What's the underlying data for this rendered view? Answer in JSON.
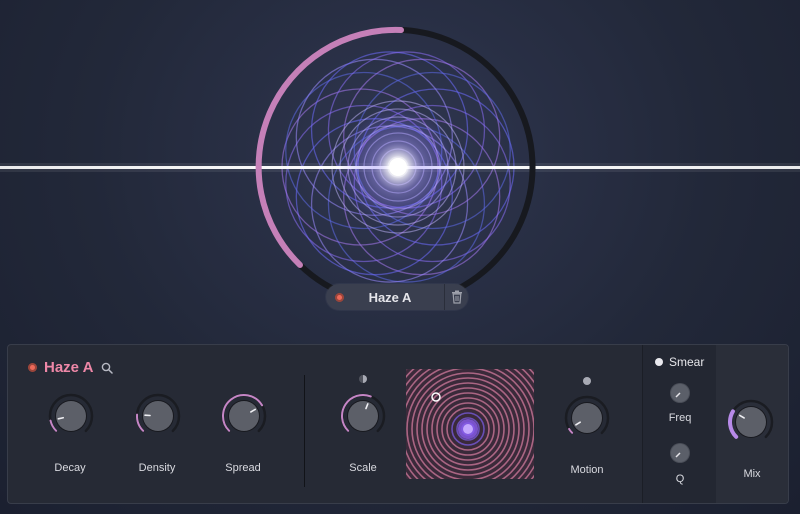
{
  "colors": {
    "accent_pink": "#ee87a7",
    "accent_purple": "#b582f0",
    "led_red": "#ee6a5a",
    "panel_bg": "#262a35"
  },
  "visualizer": {
    "description_icon": "rings-visualizer"
  },
  "preset_pill": {
    "name": "Haze A",
    "trash_icon": "trash-icon"
  },
  "module": {
    "title": "Haze A",
    "search_icon": "search-icon",
    "knobs": [
      {
        "label": "Decay",
        "value": 0.12
      },
      {
        "label": "Density",
        "value": 0.18
      },
      {
        "label": "Spread",
        "value": 0.72
      }
    ],
    "scale": {
      "label": "Scale",
      "value": 0.58
    },
    "motion": {
      "label": "Motion",
      "value": 0.05
    }
  },
  "smear": {
    "title": "Smear",
    "freq_label": "Freq",
    "q_label": "Q"
  },
  "mix": {
    "label": "Mix",
    "value": 0.28
  }
}
